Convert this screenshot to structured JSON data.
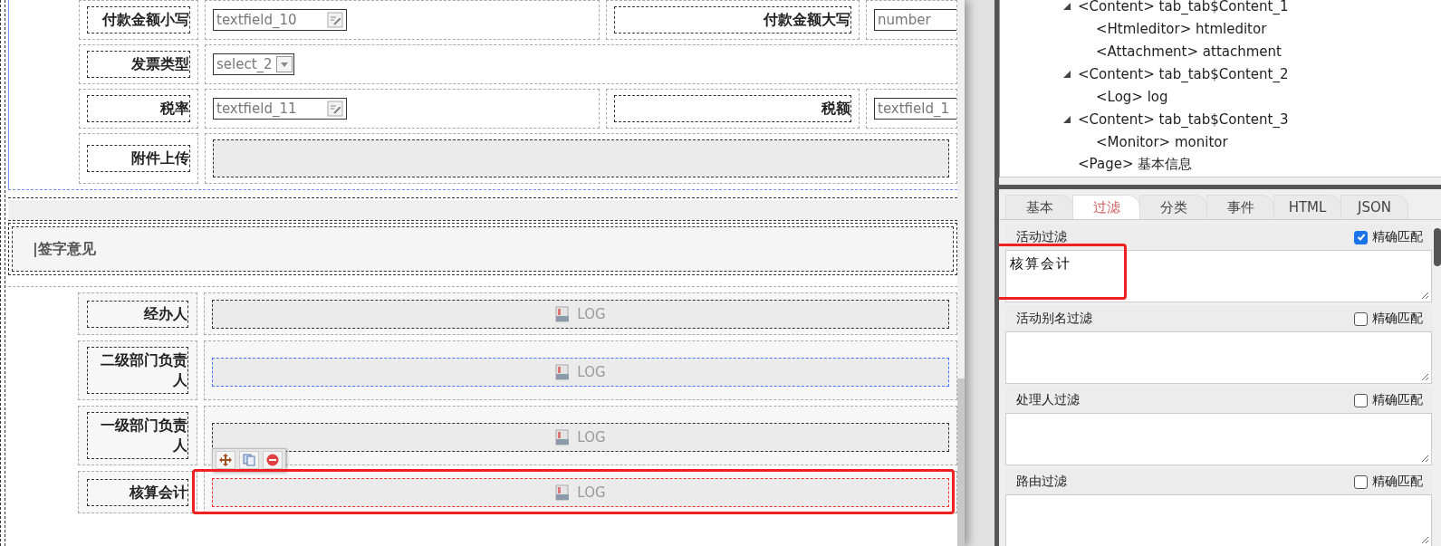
{
  "form_rows": [
    {
      "cells": [
        {
          "kind": "label",
          "text": "付款金额小写"
        },
        {
          "kind": "textfield",
          "text": "textfield_10"
        },
        {
          "kind": "label",
          "text": "付款金额大写"
        },
        {
          "kind": "input",
          "text": "number"
        }
      ]
    },
    {
      "cells": [
        {
          "kind": "label",
          "text": "发票类型"
        },
        {
          "kind": "select",
          "text": "select_2"
        }
      ]
    },
    {
      "cells": [
        {
          "kind": "label",
          "text": "税率"
        },
        {
          "kind": "textfield",
          "text": "textfield_11"
        },
        {
          "kind": "label",
          "text": "税额"
        },
        {
          "kind": "input",
          "text": "textfield_1"
        }
      ]
    },
    {
      "cells": [
        {
          "kind": "label",
          "text": "附件上传"
        },
        {
          "kind": "attachment"
        }
      ]
    }
  ],
  "section_title": "|签字意见",
  "sign_rows": [
    {
      "label": "经办人",
      "value": "LOG",
      "hovered": false,
      "selected": false
    },
    {
      "label": "二级部门负责人",
      "value": "LOG",
      "hovered": true,
      "selected": false
    },
    {
      "label": "一级部门负责人",
      "value": "LOG",
      "hovered": false,
      "selected": false
    },
    {
      "label": "核算会计",
      "value": "LOG",
      "hovered": false,
      "selected": true
    }
  ],
  "tree": [
    {
      "label": "<Content> tab_tab$Content_1",
      "expanded": true,
      "children": [
        {
          "label": "<Htmleditor> htmleditor"
        },
        {
          "label": "<Attachment> attachment"
        }
      ]
    },
    {
      "label": "<Content> tab_tab$Content_2",
      "expanded": true,
      "children": [
        {
          "label": "<Log> log"
        }
      ]
    },
    {
      "label": "<Content> tab_tab$Content_3",
      "expanded": true,
      "children": [
        {
          "label": "<Monitor> monitor"
        }
      ]
    },
    {
      "label": "<Page> 基本信息"
    }
  ],
  "tabs": [
    {
      "label": "基本",
      "selected": false
    },
    {
      "label": "过滤",
      "selected": true
    },
    {
      "label": "分类",
      "selected": false
    },
    {
      "label": "事件",
      "selected": false
    },
    {
      "label": "HTML",
      "selected": false
    },
    {
      "label": "JSON",
      "selected": false
    }
  ],
  "filters": [
    {
      "label": "活动过滤",
      "checkbox_label": "精确匹配",
      "checked": true,
      "value": "核算会计",
      "highlighted": true
    },
    {
      "label": "活动别名过滤",
      "checkbox_label": "精确匹配",
      "checked": false,
      "highlighted": false
    },
    {
      "label": "处理人过滤",
      "checkbox_label": "精确匹配",
      "checked": false,
      "highlighted": false
    },
    {
      "label": "路由过滤",
      "checkbox_label": "精确匹配",
      "checked": false,
      "highlighted": false
    }
  ]
}
